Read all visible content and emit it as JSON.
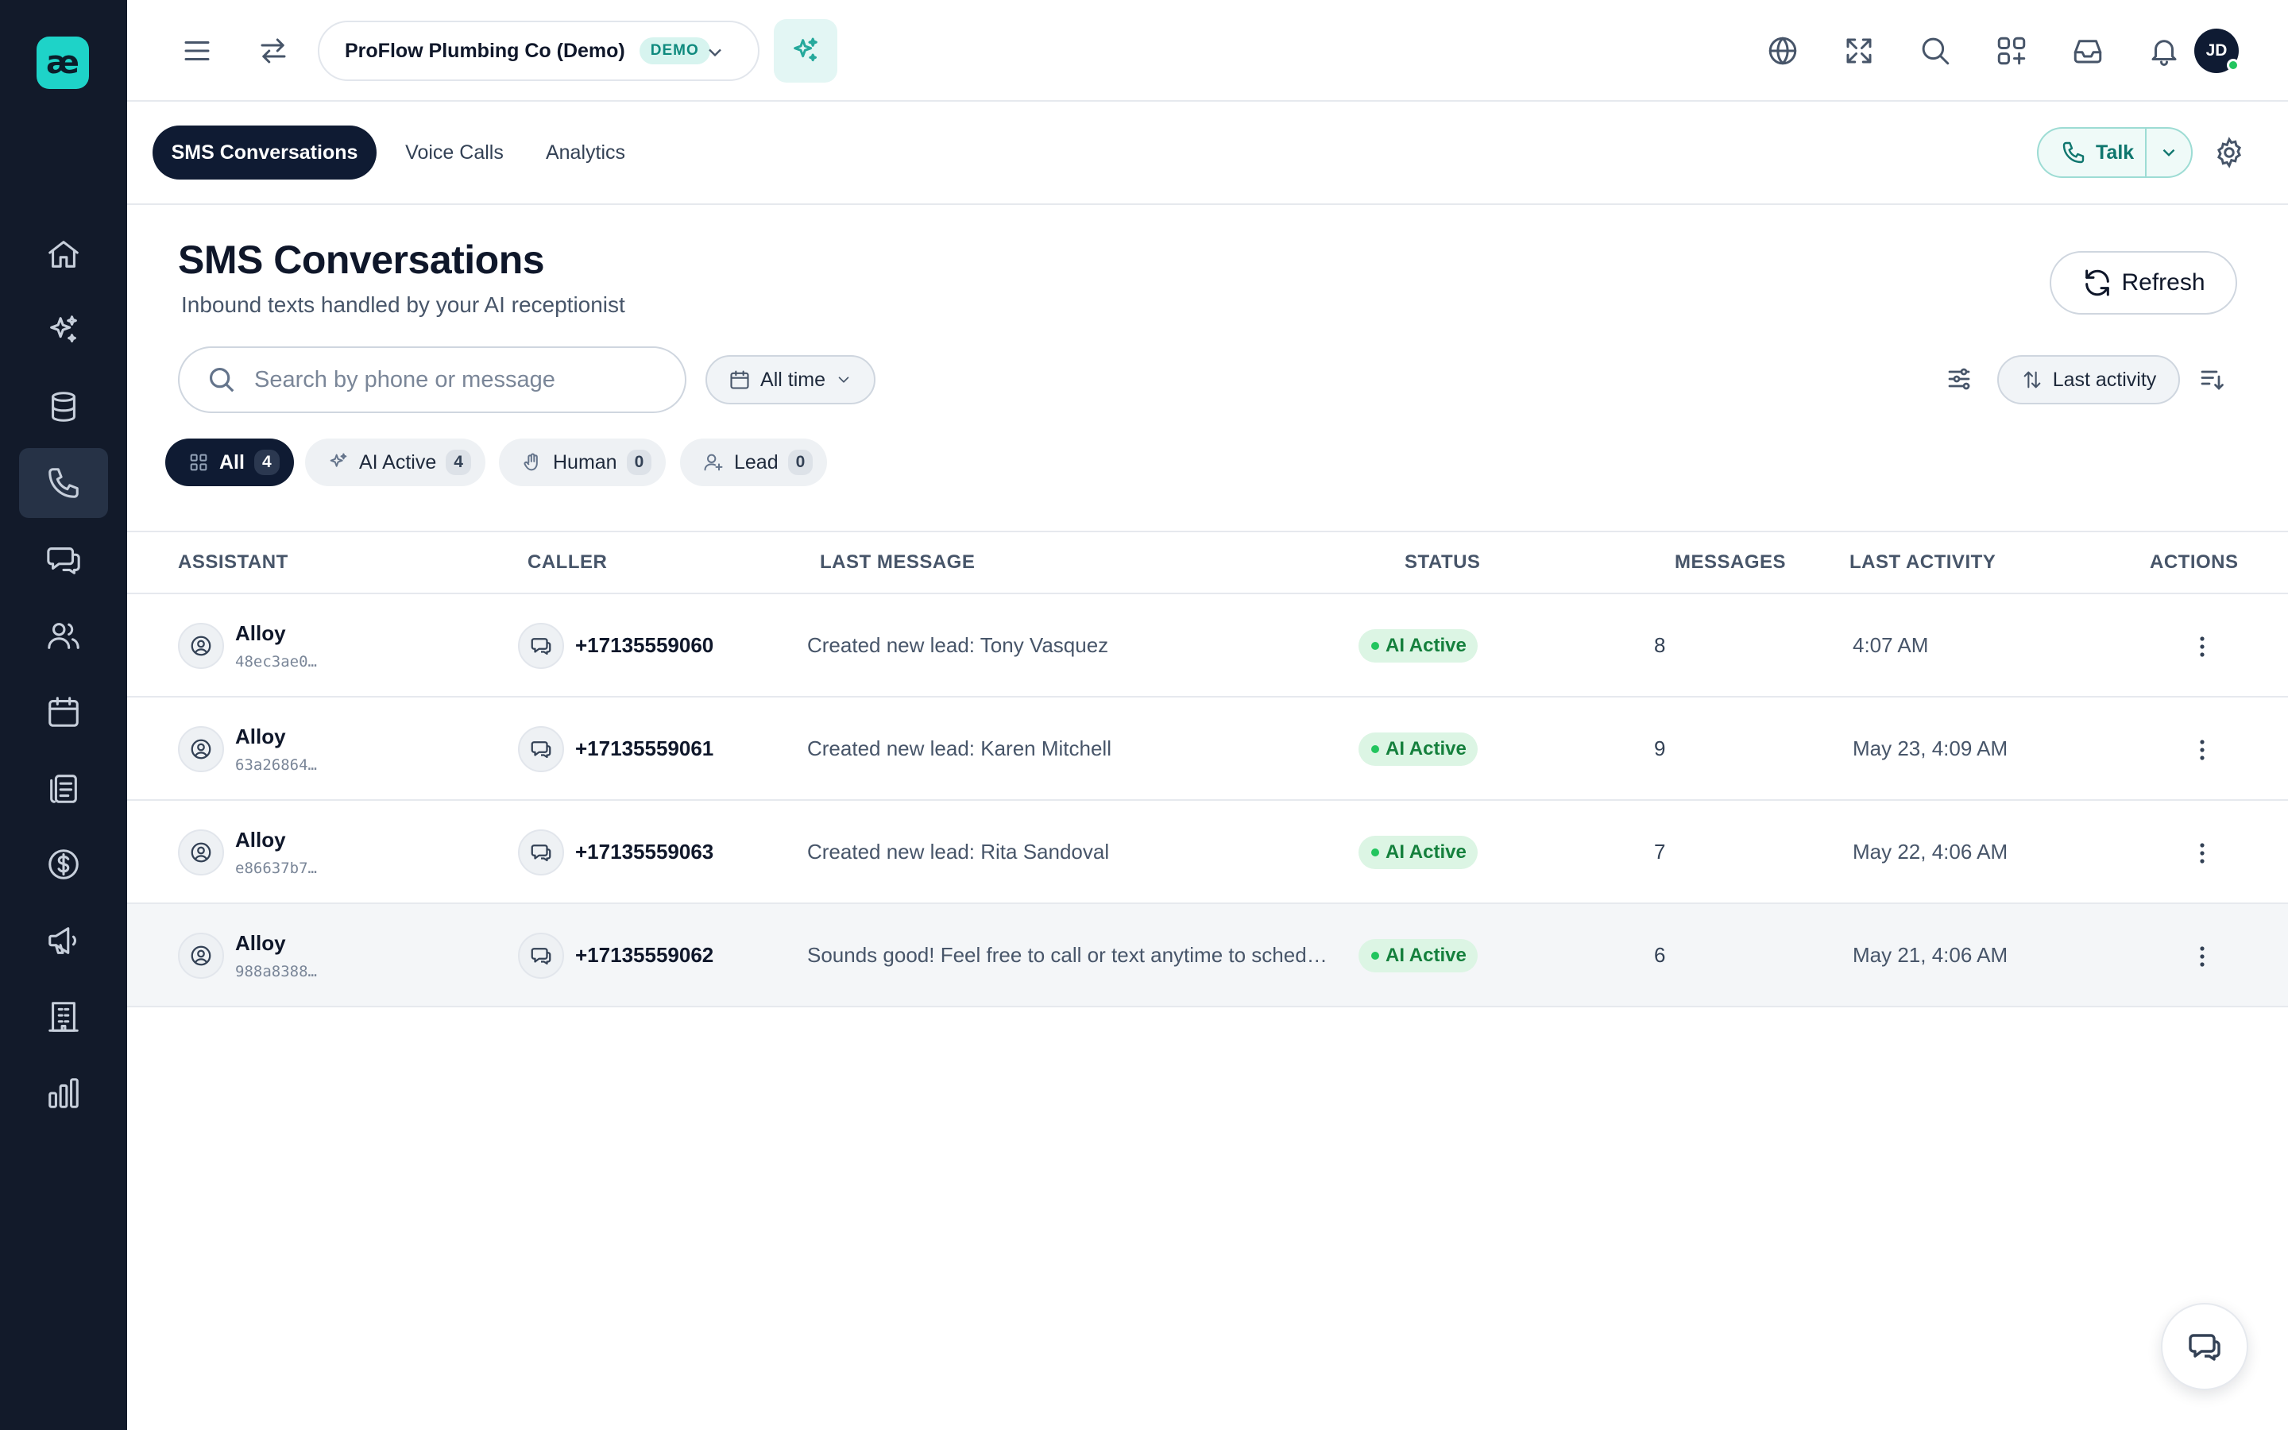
{
  "brand": {
    "logo_text": "æ",
    "accent": "#1ed3c8"
  },
  "sidebar": {
    "items": [
      {
        "icon": "home-icon",
        "active": false
      },
      {
        "icon": "sparkles-icon",
        "active": false
      },
      {
        "icon": "database-icon",
        "active": false
      },
      {
        "icon": "phone-icon",
        "active": true
      },
      {
        "icon": "chat-icon",
        "active": false
      },
      {
        "icon": "users-icon",
        "active": false
      },
      {
        "icon": "calendar-icon",
        "active": false
      },
      {
        "icon": "clipboard-icon",
        "active": false
      },
      {
        "icon": "dollar-icon",
        "active": false
      },
      {
        "icon": "megaphone-icon",
        "active": false
      },
      {
        "icon": "building-icon",
        "active": false
      },
      {
        "icon": "bar-chart-icon",
        "active": false
      }
    ]
  },
  "topbar": {
    "company_name": "ProFlow Plumbing Co (Demo)",
    "company_badge": "DEMO",
    "user_initials": "JD"
  },
  "tabs": [
    {
      "label": "SMS Conversations",
      "active": true
    },
    {
      "label": "Voice Calls",
      "active": false
    },
    {
      "label": "Analytics",
      "active": false
    }
  ],
  "talk_label": "Talk",
  "header": {
    "title": "SMS Conversations",
    "subtitle": "Inbound texts handled by your AI receptionist",
    "refresh_label": "Refresh"
  },
  "search": {
    "placeholder": "Search by phone or message",
    "value": ""
  },
  "date_filter": "All time",
  "sort_label": "Last activity",
  "filter_chips": [
    {
      "label": "All",
      "count": "4",
      "icon": "grid-icon",
      "active": true
    },
    {
      "label": "AI Active",
      "count": "4",
      "icon": "sparkles-icon",
      "active": false
    },
    {
      "label": "Human",
      "count": "0",
      "icon": "hand-icon",
      "active": false
    },
    {
      "label": "Lead",
      "count": "0",
      "icon": "user-plus-icon",
      "active": false
    }
  ],
  "table": {
    "columns": [
      "ASSISTANT",
      "CALLER",
      "LAST MESSAGE",
      "STATUS",
      "MESSAGES",
      "LAST ACTIVITY",
      "ACTIONS"
    ],
    "rows": [
      {
        "assistant": "Alloy",
        "assistant_id": "48ec3ae0…",
        "caller": "+17135559060",
        "last_message": "Created new lead: Tony Vasquez",
        "status": "AI Active",
        "messages": "8",
        "last_activity": "4:07 AM"
      },
      {
        "assistant": "Alloy",
        "assistant_id": "63a26864…",
        "caller": "+17135559061",
        "last_message": "Created new lead: Karen Mitchell",
        "status": "AI Active",
        "messages": "9",
        "last_activity": "May 23, 4:09 AM"
      },
      {
        "assistant": "Alloy",
        "assistant_id": "e86637b7…",
        "caller": "+17135559063",
        "last_message": "Created new lead: Rita Sandoval",
        "status": "AI Active",
        "messages": "7",
        "last_activity": "May 22, 4:06 AM"
      },
      {
        "assistant": "Alloy",
        "assistant_id": "988a8388…",
        "caller": "+17135559062",
        "last_message": "Sounds good! Feel free to call or text anytime to schedule. Have a great day!",
        "status": "AI Active",
        "messages": "6",
        "last_activity": "May 21, 4:06 AM"
      }
    ]
  },
  "colors": {
    "sidebar_bg": "#121a2a",
    "active_tab": "#0f1b33",
    "status_green": "#15803d",
    "status_bg": "#dcf5e4"
  }
}
